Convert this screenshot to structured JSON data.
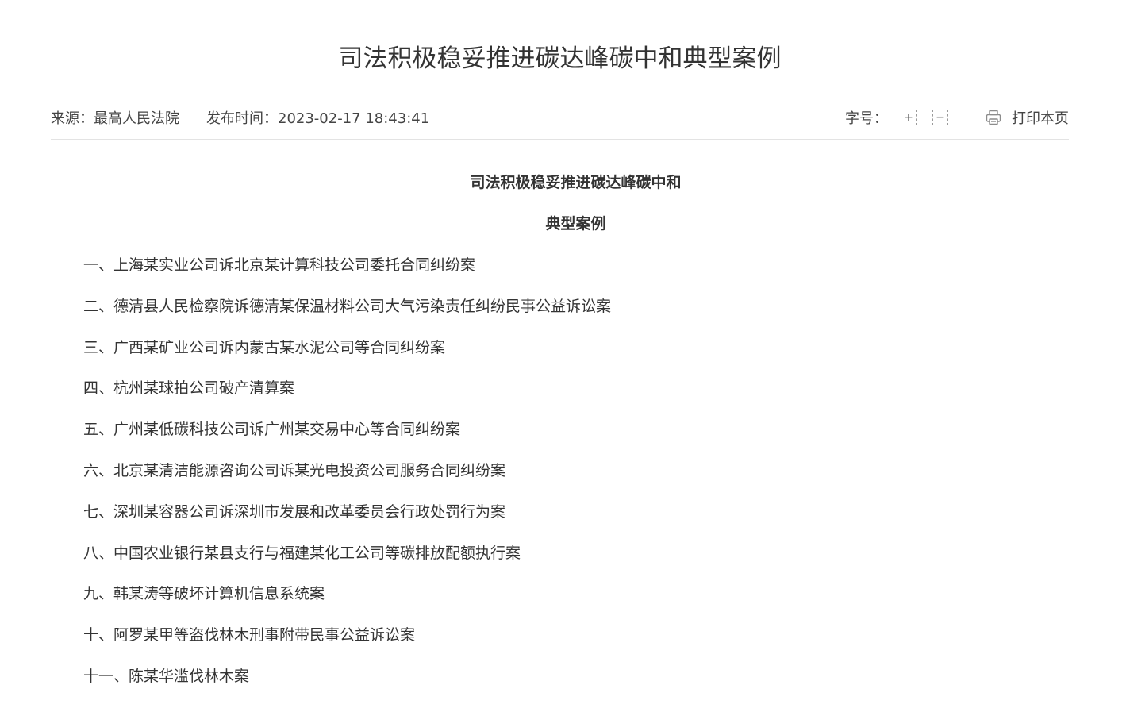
{
  "page": {
    "title": "司法积极稳妥推进碳达峰碳中和典型案例"
  },
  "meta": {
    "source": "来源：最高人民法院",
    "publish_time": "发布时间：2023-02-17 18:43:41",
    "font_size_label": "字号：",
    "font_increase": "+",
    "font_decrease": "−",
    "print_label": "打印本页"
  },
  "article": {
    "heading_line1": "司法积极稳妥推进碳达峰碳中和",
    "heading_line2": "典型案例",
    "cases": [
      "一、上海某实业公司诉北京某计算科技公司委托合同纠纷案",
      "二、德清县人民检察院诉德清某保温材料公司大气污染责任纠纷民事公益诉讼案",
      "三、广西某矿业公司诉内蒙古某水泥公司等合同纠纷案",
      "四、杭州某球拍公司破产清算案",
      "五、广州某低碳科技公司诉广州某交易中心等合同纠纷案",
      "六、北京某清洁能源咨询公司诉某光电投资公司服务合同纠纷案",
      "七、深圳某容器公司诉深圳市发展和改革委员会行政处罚行为案",
      "八、中国农业银行某县支行与福建某化工公司等碳排放配额执行案",
      "九、韩某涛等破坏计算机信息系统案",
      "十、阿罗某甲等盗伐林木刑事附带民事公益诉讼案",
      "十一、陈某华滥伐林木案"
    ]
  },
  "icons": {
    "print": "printer-icon"
  },
  "colors": {
    "text": "#333333",
    "divider": "#e3e3e3"
  }
}
